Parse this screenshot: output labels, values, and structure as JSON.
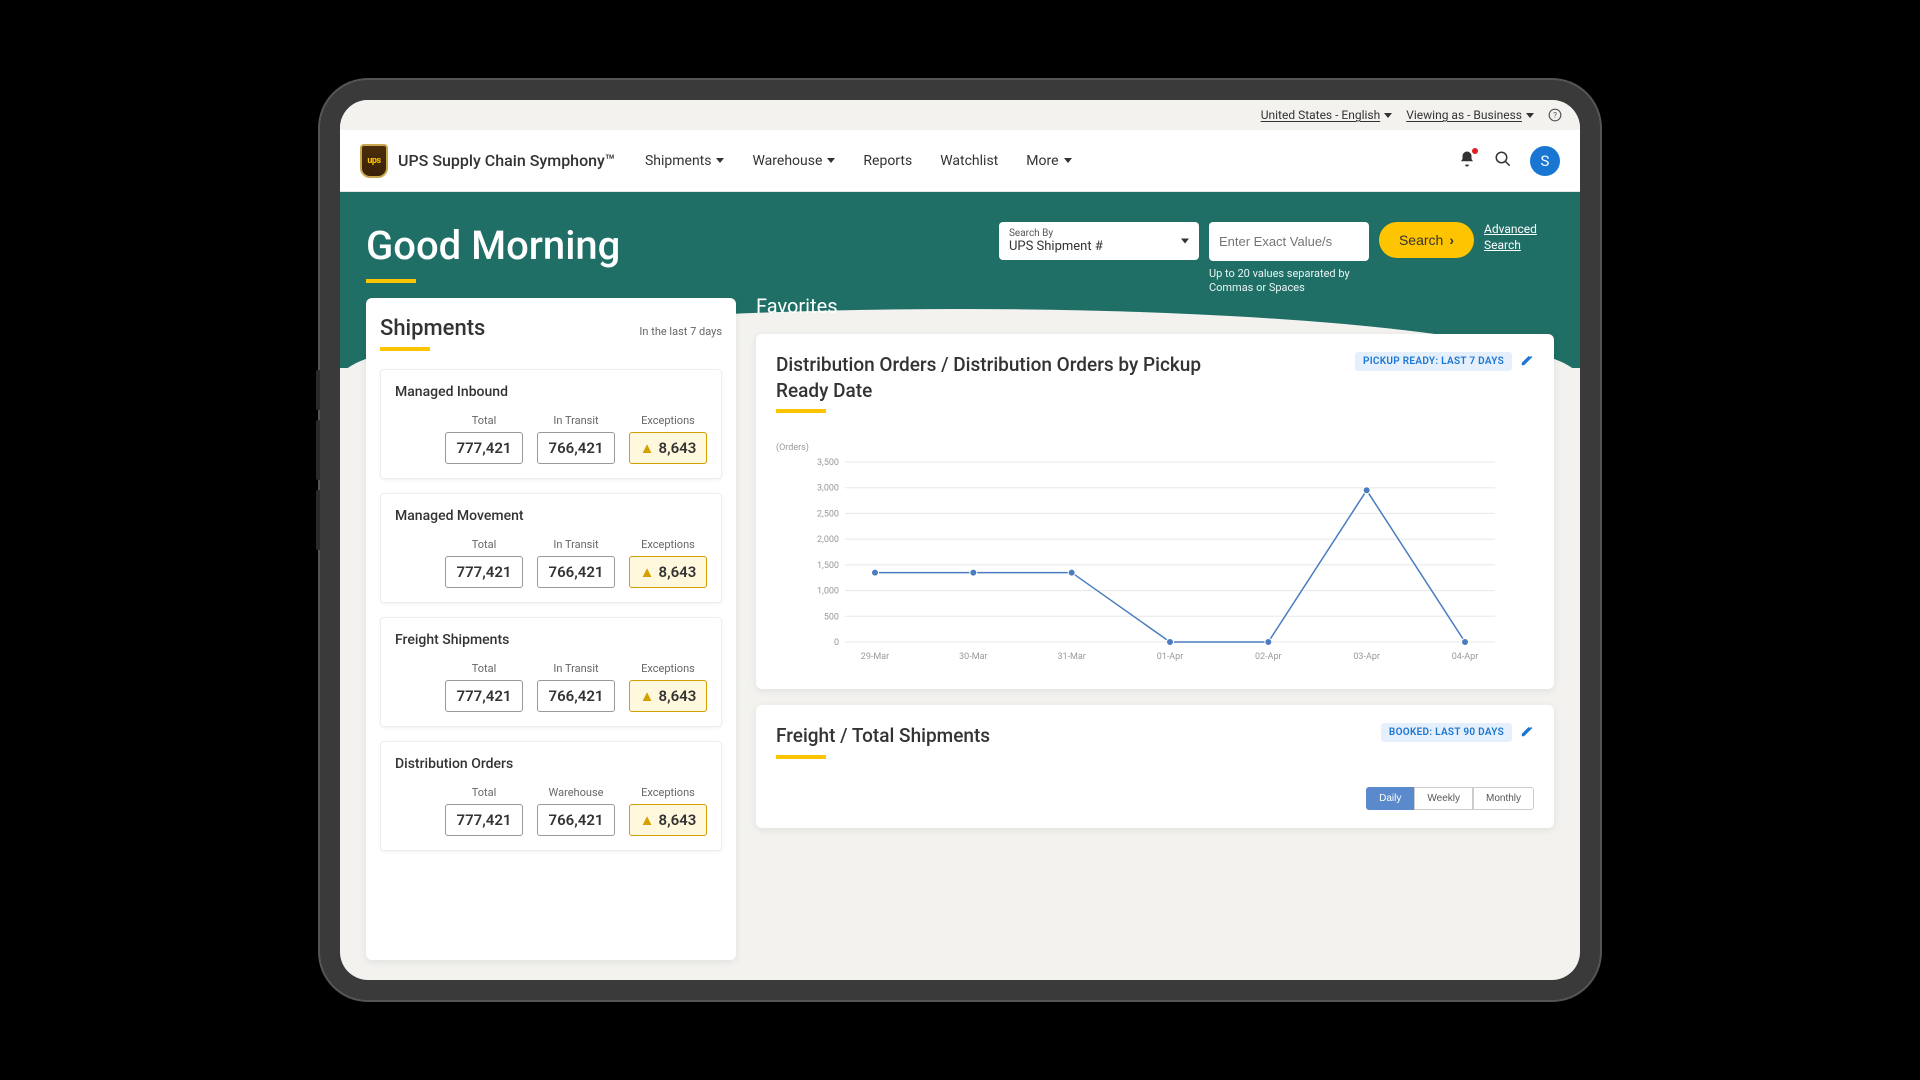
{
  "util": {
    "locale": "United States - English",
    "viewing_as": "Viewing as - Business"
  },
  "header": {
    "app_title": "UPS Supply Chain Symphony™",
    "logo_text": "ups",
    "nav": {
      "shipments": "Shipments",
      "warehouse": "Warehouse",
      "reports": "Reports",
      "watchlist": "Watchlist",
      "more": "More"
    },
    "avatar_letter": "S"
  },
  "hero": {
    "greeting": "Good Morning",
    "search_by_label": "Search By",
    "search_by_value": "UPS Shipment #",
    "search_placeholder": "Enter Exact Value/s",
    "search_hint": "Up to 20 values separated by Commas or Spaces",
    "search_button": "Search",
    "advanced_search": "Advanced Search"
  },
  "shipments": {
    "title": "Shipments",
    "subtitle": "In the last 7 days",
    "labels": {
      "total": "Total",
      "in_transit": "In Transit",
      "warehouse": "Warehouse",
      "exceptions": "Exceptions"
    },
    "groups": [
      {
        "title": "Managed Inbound",
        "col2_label": "In Transit",
        "total": "777,421",
        "col2": "766,421",
        "exceptions": "8,643"
      },
      {
        "title": "Managed Movement",
        "col2_label": "In Transit",
        "total": "777,421",
        "col2": "766,421",
        "exceptions": "8,643"
      },
      {
        "title": "Freight Shipments",
        "col2_label": "In Transit",
        "total": "777,421",
        "col2": "766,421",
        "exceptions": "8,643"
      },
      {
        "title": "Distribution Orders",
        "col2_label": "Warehouse",
        "total": "777,421",
        "col2": "766,421",
        "exceptions": "8,643"
      }
    ]
  },
  "favorites": {
    "title": "Favorites"
  },
  "chart1": {
    "title": "Distribution Orders / Distribution Orders by Pickup Ready Date",
    "badge": "PICKUP READY: LAST 7 DAYS",
    "ylabel": "(Orders)"
  },
  "chart2": {
    "title": "Freight / Total Shipments",
    "badge": "BOOKED: LAST 90 DAYS",
    "toggles": {
      "daily": "Daily",
      "weekly": "Weekly",
      "monthly": "Monthly"
    }
  },
  "chart_data": {
    "type": "line",
    "title": "Distribution Orders by Pickup Ready Date",
    "xlabel": "",
    "ylabel": "(Orders)",
    "ylim": [
      0,
      3500
    ],
    "yticks": [
      0,
      500,
      1000,
      1500,
      2000,
      2500,
      3000,
      3500
    ],
    "categories": [
      "29-Mar",
      "30-Mar",
      "31-Mar",
      "01-Apr",
      "02-Apr",
      "03-Apr",
      "04-Apr"
    ],
    "values": [
      1350,
      1350,
      1350,
      0,
      0,
      2950,
      0
    ]
  }
}
